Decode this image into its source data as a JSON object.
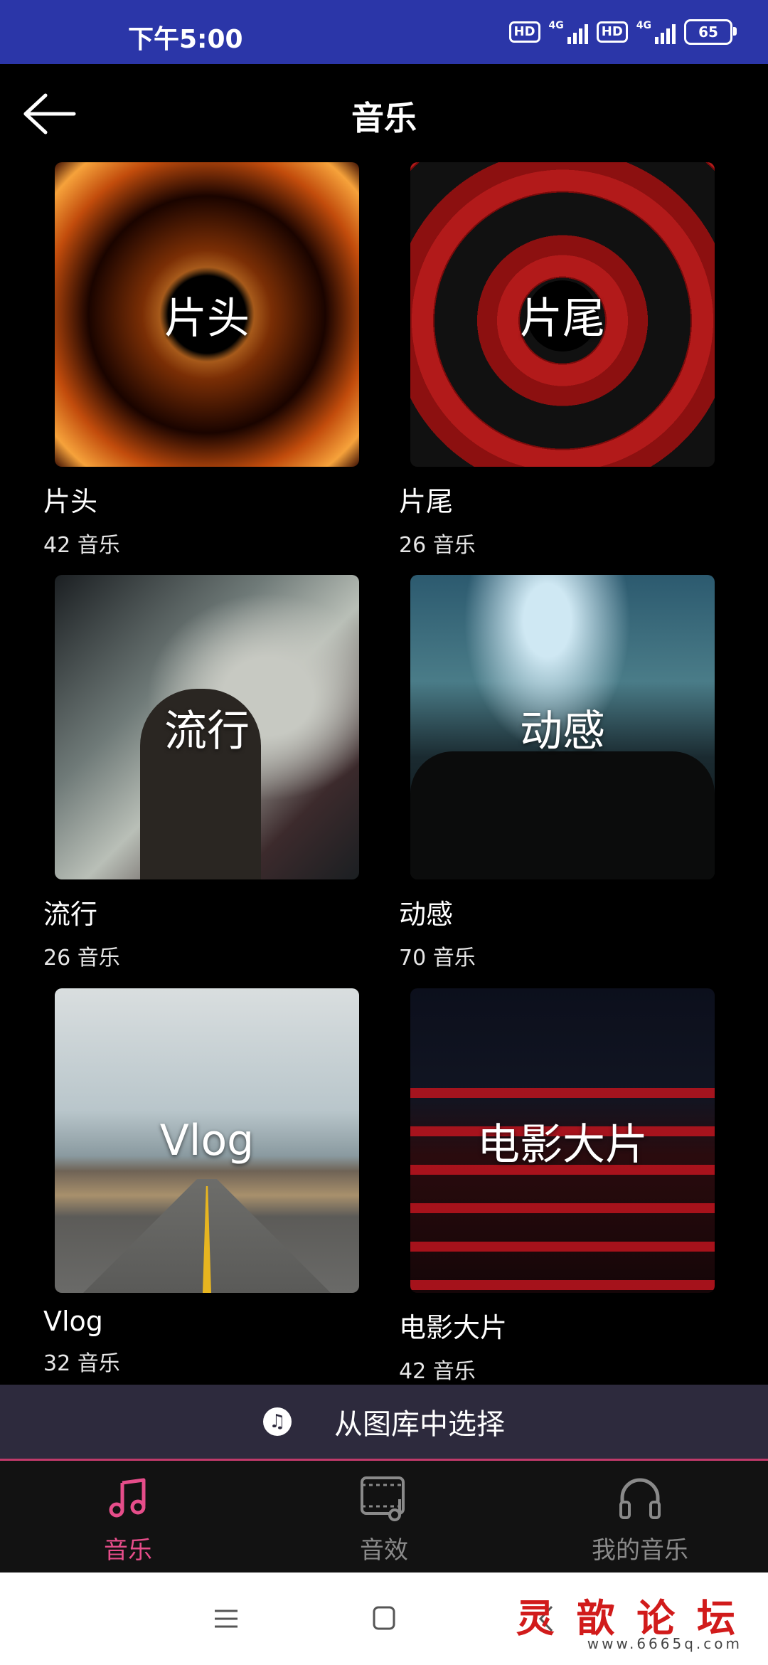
{
  "status_bar": {
    "time": "下午5:00",
    "hd1": "HD",
    "net1": "4G",
    "hd2": "HD",
    "net2": "4G",
    "battery": "65"
  },
  "header": {
    "back_icon": "arrow-left-icon",
    "title": "音乐"
  },
  "categories": [
    {
      "overlay": "片头",
      "name": "片头",
      "count": "42 音乐"
    },
    {
      "overlay": "片尾",
      "name": "片尾",
      "count": "26 音乐"
    },
    {
      "overlay": "流行",
      "name": "流行",
      "count": "26 音乐"
    },
    {
      "overlay": "动感",
      "name": "动感",
      "count": "70 音乐"
    },
    {
      "overlay": "Vlog",
      "name": "Vlog",
      "count": "32 音乐"
    },
    {
      "overlay": "电影大片",
      "name": "电影大片",
      "count": "42 音乐"
    }
  ],
  "gallery": {
    "icon": "music-note-icon",
    "label": "从图库中选择"
  },
  "bottom_nav": {
    "items": [
      {
        "label": "音乐",
        "icon": "music-note-icon",
        "active": true
      },
      {
        "label": "音效",
        "icon": "film-music-icon",
        "active": false
      },
      {
        "label": "我的音乐",
        "icon": "headphones-icon",
        "active": false
      }
    ],
    "active_color": "#e64d8a"
  },
  "system_nav": {
    "watermark": "灵 歆 论 坛",
    "watermark_sub": "www.6665q.com"
  }
}
